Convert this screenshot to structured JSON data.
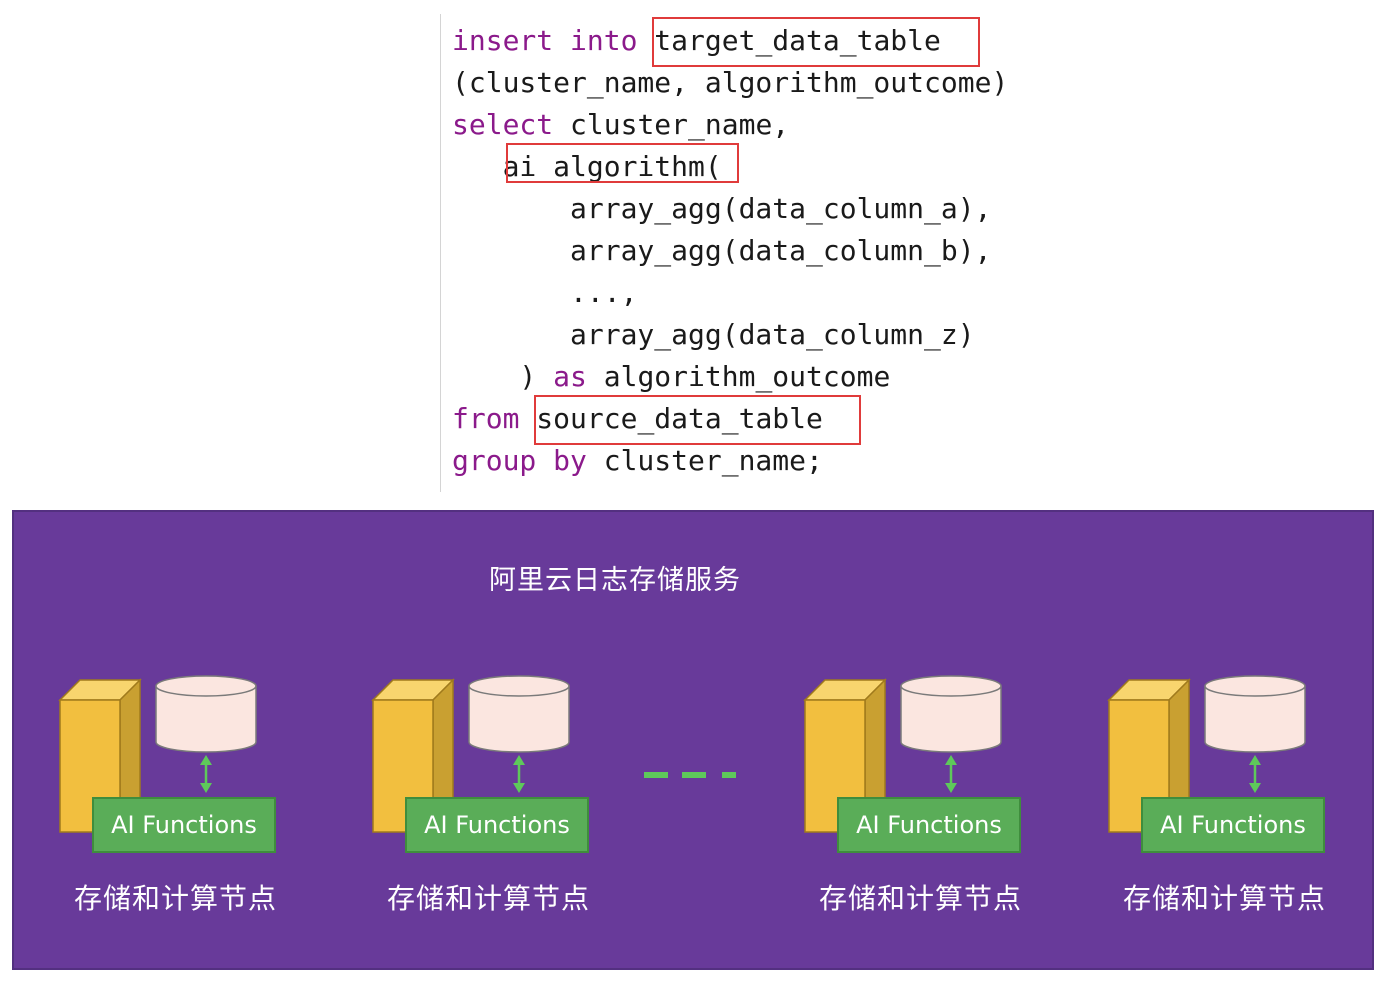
{
  "code": {
    "lines": [
      {
        "kw": "insert into",
        "rest": " target_data_table"
      },
      {
        "kw": "",
        "rest": "(cluster_name, algorithm_outcome)"
      },
      {
        "kw": "select",
        "rest": " cluster_name,"
      },
      {
        "kw": "",
        "rest": "   ai_algorithm("
      },
      {
        "kw": "",
        "rest": "       array_agg(data_column_a),"
      },
      {
        "kw": "",
        "rest": "       array_agg(data_column_b),"
      },
      {
        "kw": "",
        "rest": "       ...,"
      },
      {
        "kw": "",
        "rest": "       array_agg(data_column_z)"
      },
      {
        "pre": "    ) ",
        "kw": "as",
        "rest": " algorithm_outcome"
      },
      {
        "kw": "from",
        "rest": " source_data_table"
      },
      {
        "kw": "group by",
        "rest": " cluster_name;"
      }
    ]
  },
  "service": {
    "title": "阿里云日志存储服务",
    "nodes": [
      {
        "function_label": "AI Functions",
        "label": "存储和计算节点"
      },
      {
        "function_label": "AI Functions",
        "label": "存储和计算节点"
      },
      {
        "function_label": "AI Functions",
        "label": "存储和计算节点"
      },
      {
        "function_label": "AI Functions",
        "label": "存储和计算节点"
      }
    ]
  },
  "colors": {
    "keyword": "#8b1a8b",
    "highlight_box": "#e03b3b",
    "panel_background": "#683a9a",
    "server": "#f2bf3f",
    "database": "#fbe6e0",
    "ai_functions": "#5aad58"
  }
}
